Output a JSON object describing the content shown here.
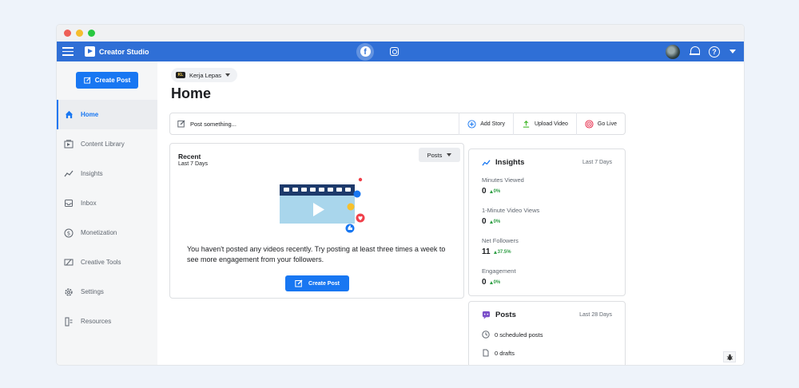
{
  "window": {
    "dots": [
      "#ee5f57",
      "#f5bd2e",
      "#29c840"
    ]
  },
  "topbar": {
    "brand": "Creator Studio",
    "color": "#2f6fd6",
    "facebook_glyph": "f"
  },
  "sidebar": {
    "create_post": "Create Post",
    "items": [
      {
        "label": "Home",
        "icon": "home-icon",
        "active": true
      },
      {
        "label": "Content Library",
        "icon": "library-icon"
      },
      {
        "label": "Insights",
        "icon": "insights-icon"
      },
      {
        "label": "Inbox",
        "icon": "inbox-icon"
      },
      {
        "label": "Monetization",
        "icon": "dollar-icon"
      },
      {
        "label": "Creative Tools",
        "icon": "tools-icon"
      },
      {
        "label": "Settings",
        "icon": "gear-icon"
      },
      {
        "label": "Resources",
        "icon": "resources-icon"
      }
    ]
  },
  "main": {
    "page_name": "Kerja Lepas",
    "page_logo_text": "KL",
    "title": "Home",
    "composer": {
      "placeholder": "Post something...",
      "add_story": "Add Story",
      "upload_video": "Upload Video",
      "go_live": "Go Live"
    },
    "recent": {
      "title": "Recent",
      "range": "Last 7 Days",
      "filter": "Posts",
      "empty_text": "You haven't posted any videos recently. Try posting at least three times a week to see more engagement from your followers.",
      "create_post": "Create Post"
    },
    "insights": {
      "title": "Insights",
      "range": "Last 7 Days",
      "metrics": [
        {
          "label": "Minutes Viewed",
          "value": "0",
          "change": "0%"
        },
        {
          "label": "1-Minute Video Views",
          "value": "0",
          "change": "0%"
        },
        {
          "label": "Net Followers",
          "value": "11",
          "change": "37.5%"
        },
        {
          "label": "Engagement",
          "value": "0",
          "change": "0%"
        }
      ]
    },
    "posts": {
      "title": "Posts",
      "range": "Last 28 Days",
      "scheduled": "0 scheduled posts",
      "drafts": "0 drafts"
    }
  }
}
